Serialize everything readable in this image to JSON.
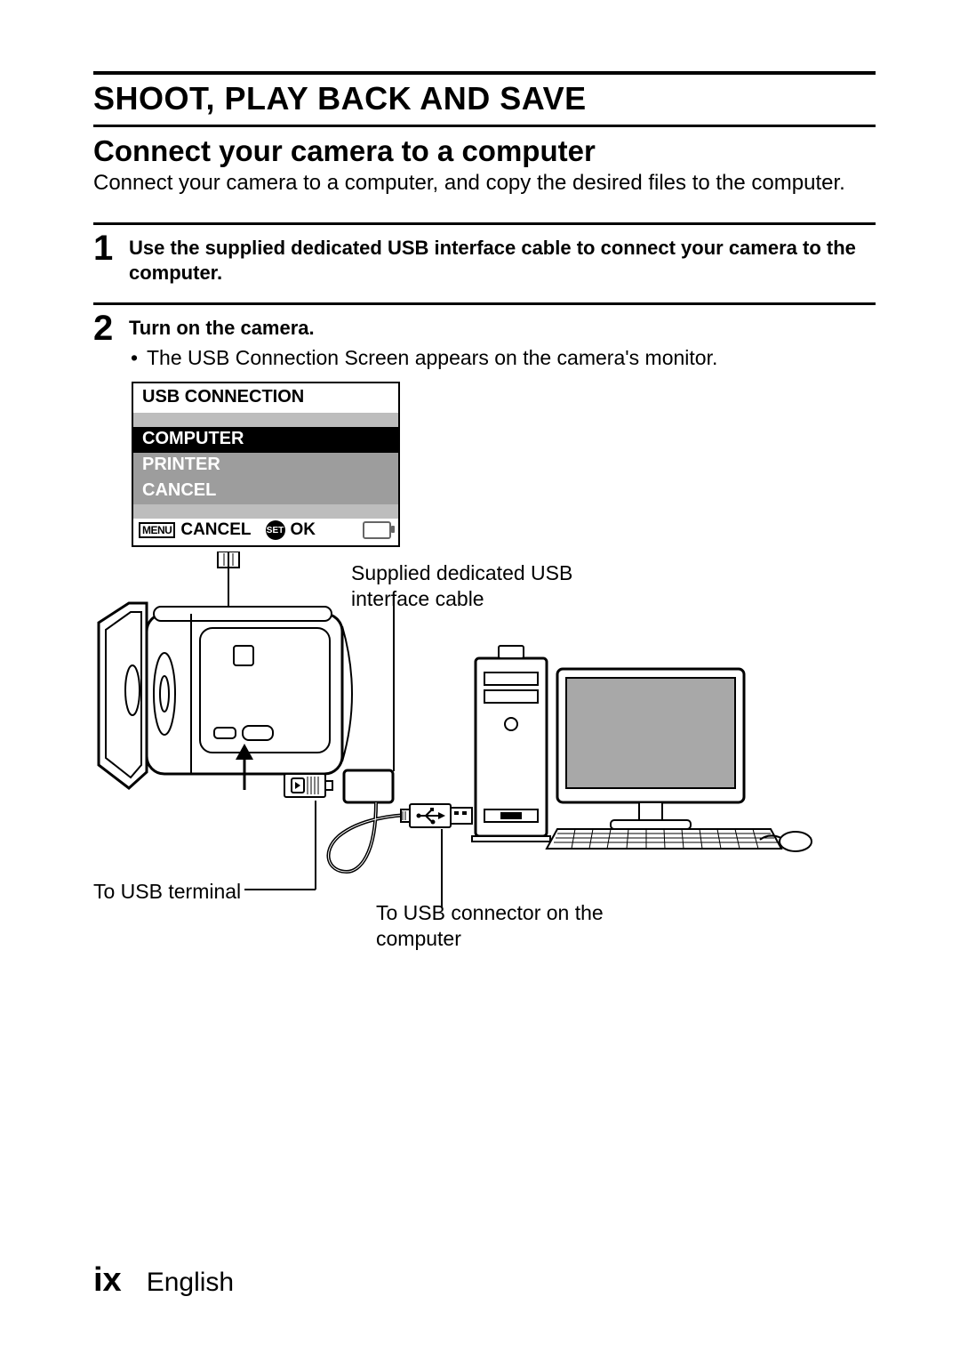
{
  "section_title": "SHOOT, PLAY BACK AND SAVE",
  "subsection_title": "Connect your camera to a computer",
  "intro_text": "Connect your camera to a computer, and copy the desired files to the computer.",
  "steps": [
    {
      "num": "1",
      "bold": "Use the supplied dedicated USB interface cable to connect your camera to the computer."
    },
    {
      "num": "2",
      "bold": "Turn on the camera.",
      "bullet": "The USB Connection Screen appears on the camera's monitor."
    }
  ],
  "screen": {
    "title": "USB CONNECTION",
    "rows": [
      "COMPUTER",
      "PRINTER",
      "CANCEL"
    ],
    "menu_badge": "MENU",
    "cancel_label": "CANCEL",
    "set_badge": "SET",
    "ok_label": "OK"
  },
  "labels": {
    "cable": "Supplied dedicated USB interface cable",
    "to_terminal": "To USB terminal",
    "to_computer": "To USB connector on the computer"
  },
  "footer": {
    "page": "ix",
    "lang": "English"
  }
}
